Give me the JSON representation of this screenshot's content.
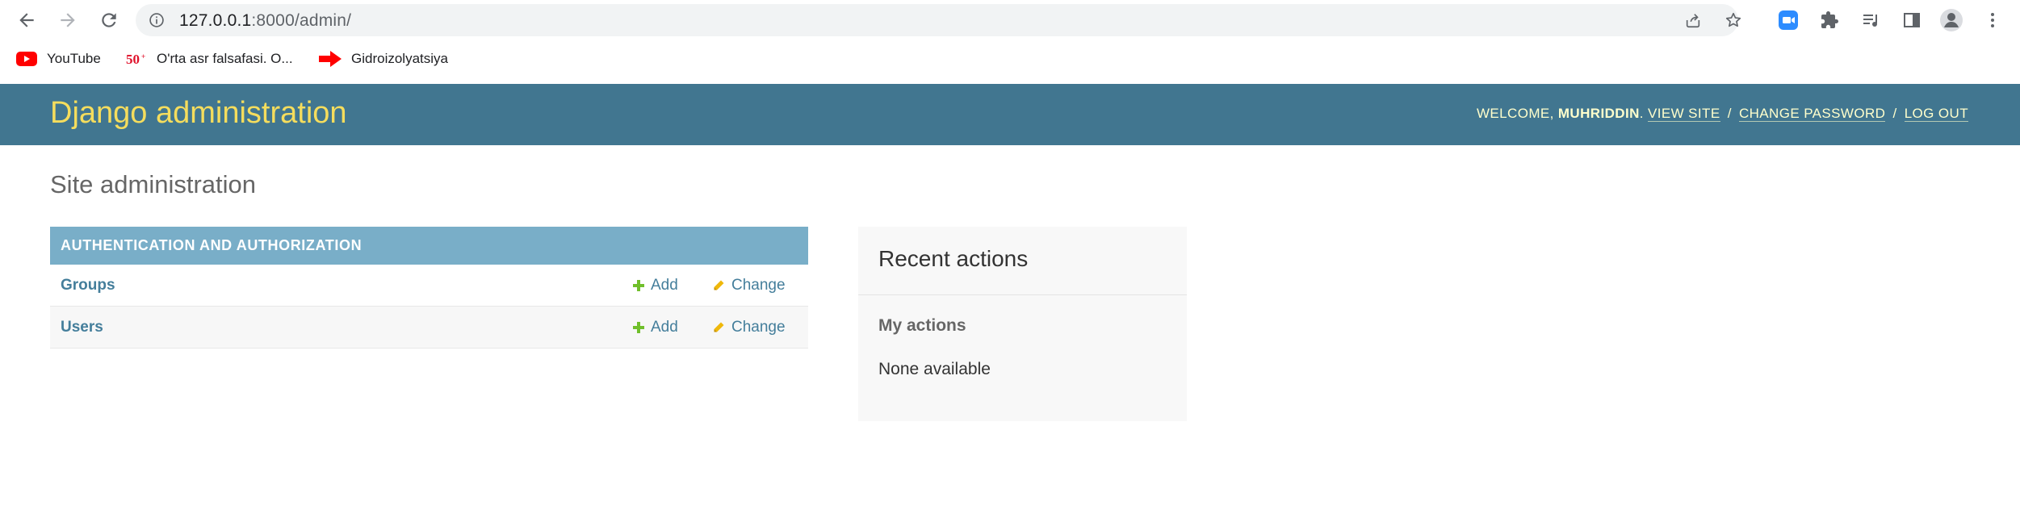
{
  "browser": {
    "url_host": "127.0.0.1",
    "url_path": ":8000/admin/",
    "bookmarks": [
      {
        "label": "YouTube",
        "icon": "youtube-icon"
      },
      {
        "label": "O'rta asr falsafasi. O...",
        "icon": "50-plus-icon"
      },
      {
        "label": "Gidroizolyatsiya",
        "icon": "red-arrow-icon"
      }
    ]
  },
  "header": {
    "branding": "Django administration",
    "welcome": "Welcome,",
    "username": "Muhriddin",
    "view_site": "View site",
    "change_password": "Change password",
    "log_out": "Log out"
  },
  "content": {
    "title": "Site administration",
    "app_module": {
      "caption": "Authentication and Authorization",
      "models": [
        {
          "name": "Groups",
          "add_label": "Add",
          "change_label": "Change"
        },
        {
          "name": "Users",
          "add_label": "Add",
          "change_label": "Change"
        }
      ]
    }
  },
  "recent_actions": {
    "title": "Recent actions",
    "subtitle": "My actions",
    "empty_text": "None available"
  },
  "colors": {
    "header_bg": "#417690",
    "branding": "#f5dd5d",
    "caption_bg": "#79aec8",
    "link": "#447e9b",
    "add_icon": "#70bf2b",
    "change_icon": "#efb80b"
  }
}
